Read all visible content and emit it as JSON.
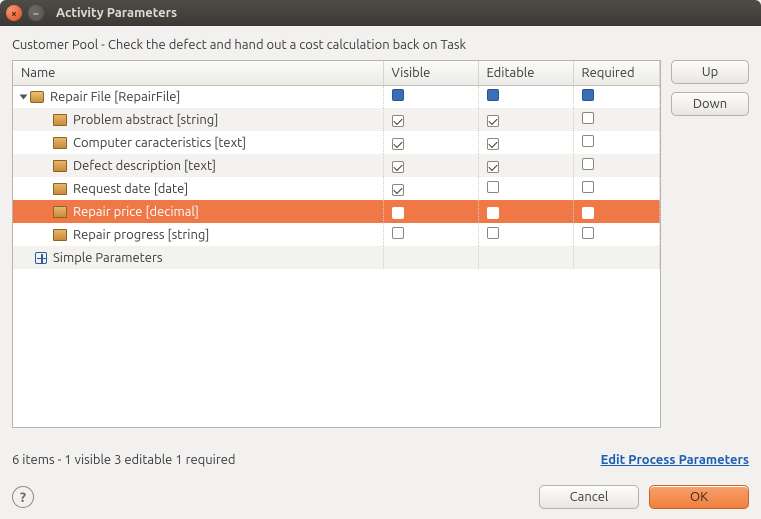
{
  "window": {
    "title": "Activity Parameters"
  },
  "subtitle": "Customer Pool  - Check the defect and hand out a cost calculation back on Task",
  "columns": {
    "name": "Name",
    "visible": "Visible",
    "editable": "Editable",
    "required": "Required"
  },
  "rows": [
    {
      "label": "Repair File [RepairFile]",
      "kind": "root",
      "visible": "hard",
      "editable": "hard",
      "required": "hard",
      "selected": false
    },
    {
      "label": "Problem abstract [string]",
      "kind": "field",
      "visible": true,
      "editable": true,
      "required": false,
      "selected": false
    },
    {
      "label": "Computer caracteristics [text]",
      "kind": "field",
      "visible": true,
      "editable": true,
      "required": false,
      "selected": false
    },
    {
      "label": "Defect description [text]",
      "kind": "field",
      "visible": true,
      "editable": true,
      "required": false,
      "selected": false
    },
    {
      "label": "Request date [date]",
      "kind": "field",
      "visible": true,
      "editable": false,
      "required": false,
      "selected": false
    },
    {
      "label": "Repair price [decimal]",
      "kind": "field",
      "visible": true,
      "editable": true,
      "required": true,
      "selected": true
    },
    {
      "label": "Repair progress [string]",
      "kind": "field",
      "visible": false,
      "editable": false,
      "required": false,
      "selected": false
    },
    {
      "label": "Simple Parameters",
      "kind": "simple",
      "visible": null,
      "editable": null,
      "required": null,
      "selected": false
    }
  ],
  "sideButtons": {
    "up": "Up",
    "down": "Down"
  },
  "status": "6 items - 1 visible  3 editable  1 required",
  "editLink": "Edit Process Parameters",
  "bottomButtons": {
    "cancel": "Cancel",
    "ok": "OK"
  }
}
